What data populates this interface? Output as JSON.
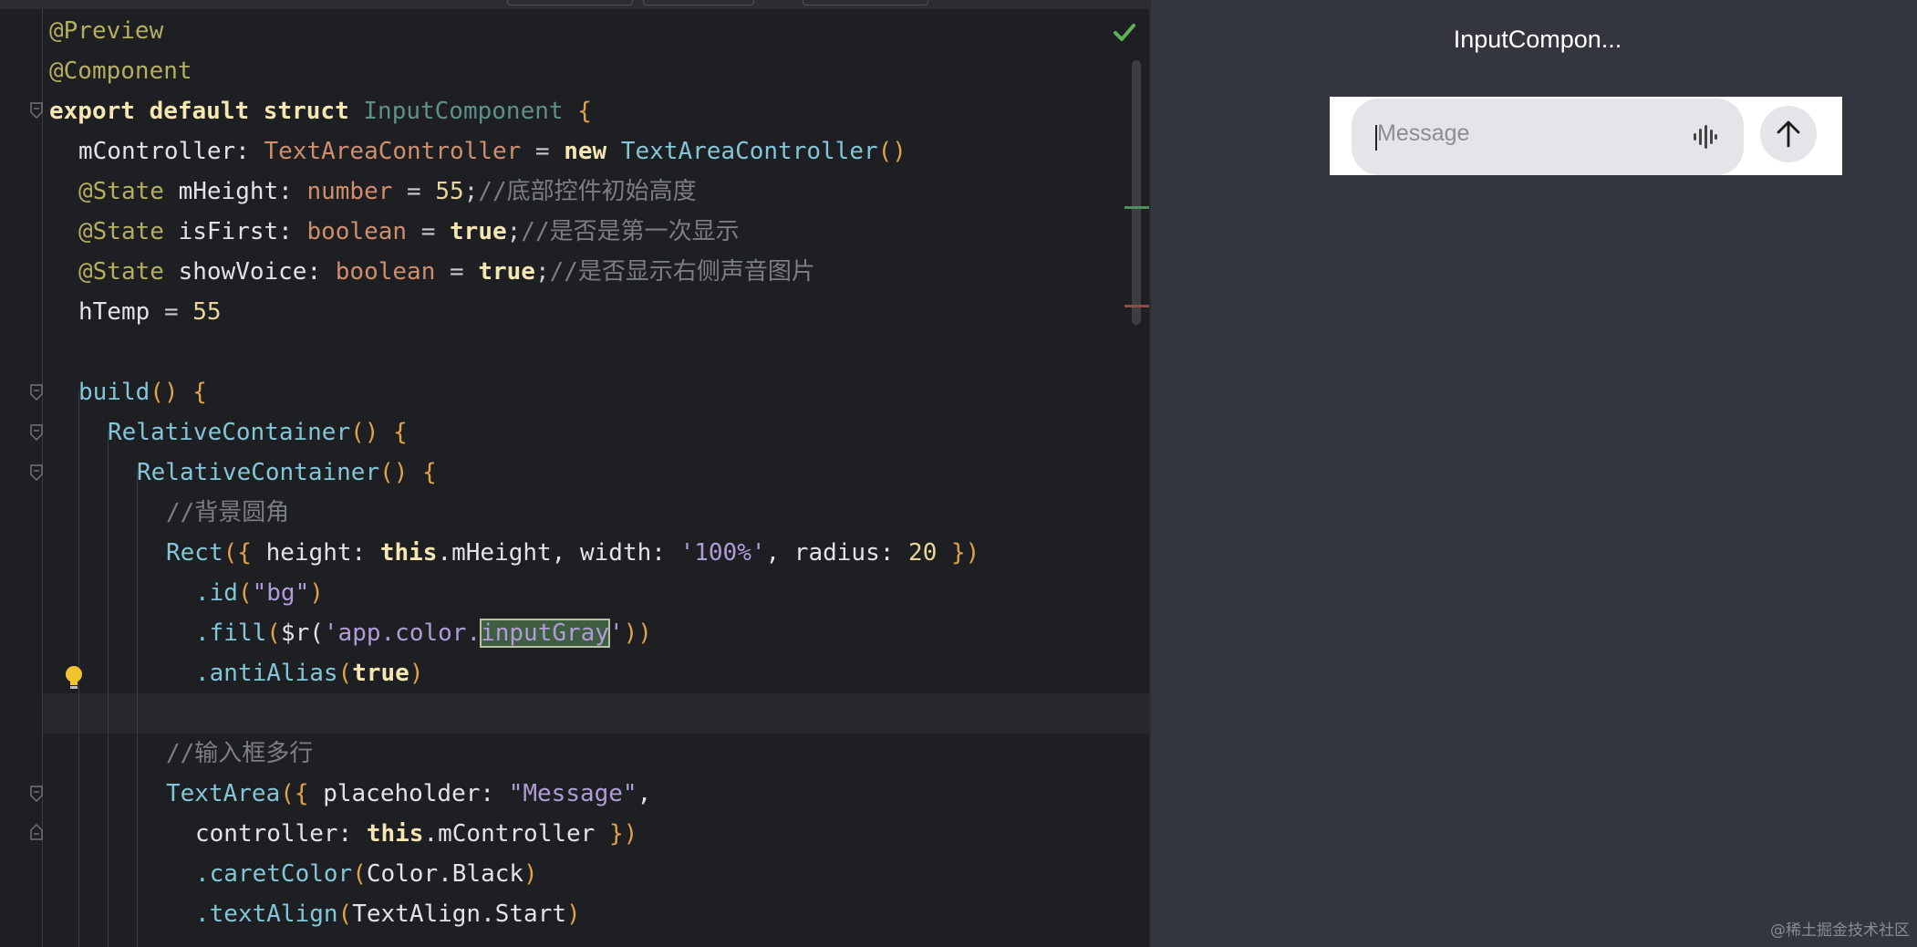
{
  "editor": {
    "lines": [
      [
        "@Preview"
      ],
      [
        "@Component"
      ],
      [
        "export default struct",
        "InputComponent",
        "{"
      ],
      [
        "mController:",
        "TextAreaController",
        "=",
        "new",
        "TextAreaController",
        "()"
      ],
      [
        "@State",
        "mHeight:",
        "number",
        "=",
        "55",
        ";",
        "//底部控件初始高度"
      ],
      [
        "@State",
        "isFirst:",
        "boolean",
        "=",
        "true",
        ";",
        "//是否是第一次显示"
      ],
      [
        "@State",
        "showVoice:",
        "boolean",
        "=",
        "true",
        ";",
        "//是否显示右侧声音图片"
      ],
      [
        "hTemp",
        "=",
        "55"
      ],
      [
        ""
      ],
      [
        "build",
        "()",
        "{"
      ],
      [
        "RelativeContainer",
        "()",
        "{"
      ],
      [
        "RelativeContainer",
        "()",
        "{"
      ],
      [
        "//背景圆角"
      ],
      [
        "Rect",
        "({",
        "height:",
        "this",
        ".mHeight,",
        "width:",
        "'100%'",
        ", radius:",
        "20",
        "})"
      ],
      [
        ".id",
        "(",
        "\"bg\"",
        ")"
      ],
      [
        ".fill",
        "(",
        "$r(",
        "'app.color.",
        "inputGray",
        "'",
        "))"
      ],
      [
        ".antiAlias",
        "(",
        "true",
        ")"
      ],
      [
        ""
      ],
      [
        "//输入框多行"
      ],
      [
        "TextArea",
        "({",
        "placeholder:",
        "\"Message\"",
        ","
      ],
      [
        "controller:",
        "this",
        ".mController",
        "})"
      ],
      [
        ".caretColor",
        "(",
        "Color.Black",
        ")"
      ],
      [
        ".textAlign",
        "(",
        "TextAlign.Start",
        ")"
      ]
    ]
  },
  "preview": {
    "title": "InputCompon...",
    "input_placeholder": "Message",
    "voice_icon": "voice-waveform-icon",
    "send_icon": "arrow-up-icon"
  },
  "watermark": "@稀土掘金技术社区",
  "colors": {
    "editor_bg": "#1e1f22",
    "preview_bg": "#33363f",
    "input_bg": "#e5e4e9",
    "keyword": "#f5e6b2",
    "annotation": "#b3ae60",
    "type": "#cf8e6d",
    "string": "#b09cd8",
    "comment": "#7a7e85"
  }
}
